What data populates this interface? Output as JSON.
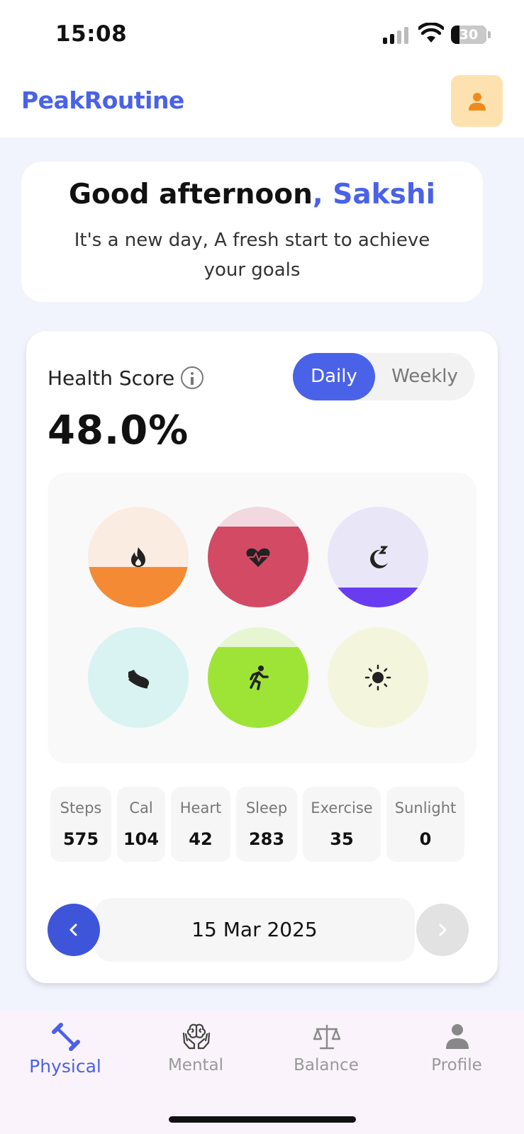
{
  "status_bar": {
    "time": "15:08",
    "battery": "30"
  },
  "header": {
    "brand": "PeakRoutine"
  },
  "greeting": {
    "title": "Good afternoon",
    "separator": ", ",
    "name": "Sakshi",
    "subtitle": "It's a new day, A fresh start to achieve your goals"
  },
  "health": {
    "label": "Health Score",
    "value": "48.0%",
    "toggle": {
      "daily": "Daily",
      "weekly": "Weekly",
      "selected": "Daily"
    },
    "rings": [
      {
        "name": "calories",
        "icon": "flame-icon",
        "fill_fraction": 0.4,
        "bg": "#fbece2",
        "fill": "#f58a35"
      },
      {
        "name": "heart",
        "icon": "heart-pulse-icon",
        "fill_fraction": 0.8,
        "bg": "#f2d8df",
        "fill": "#d24a64"
      },
      {
        "name": "sleep",
        "icon": "moon-sleep-icon",
        "fill_fraction": 0.2,
        "bg": "#e9e6f7",
        "fill": "#6a3cf1"
      },
      {
        "name": "steps",
        "icon": "shoe-icon",
        "fill_fraction": 0.0,
        "bg": "#d8f3f2",
        "fill": "#3ccdc7"
      },
      {
        "name": "exercise",
        "icon": "running-icon",
        "fill_fraction": 0.8,
        "bg": "#e7f5d3",
        "fill": "#9ee437"
      },
      {
        "name": "sunlight",
        "icon": "sun-icon",
        "fill_fraction": 0.0,
        "bg": "#f3f6dd",
        "fill": "#e7e85a"
      }
    ],
    "stats": [
      {
        "label": "Steps",
        "value": "575"
      },
      {
        "label": "Cal",
        "value": "104"
      },
      {
        "label": "Heart",
        "value": "42"
      },
      {
        "label": "Sleep",
        "value": "283"
      },
      {
        "label": "Exercise",
        "value": "35"
      },
      {
        "label": "Sunlight",
        "value": "0"
      }
    ],
    "date": "15 Mar 2025"
  },
  "tabs": [
    {
      "label": "Physical",
      "icon": "dumbbell-icon",
      "active": true
    },
    {
      "label": "Mental",
      "icon": "brain-hands-icon",
      "active": false
    },
    {
      "label": "Balance",
      "icon": "scale-icon",
      "active": false
    },
    {
      "label": "Profile",
      "icon": "person-icon",
      "active": false
    }
  ],
  "colors": {
    "accent": "#4a62e8",
    "background": "#f1f4fd"
  }
}
